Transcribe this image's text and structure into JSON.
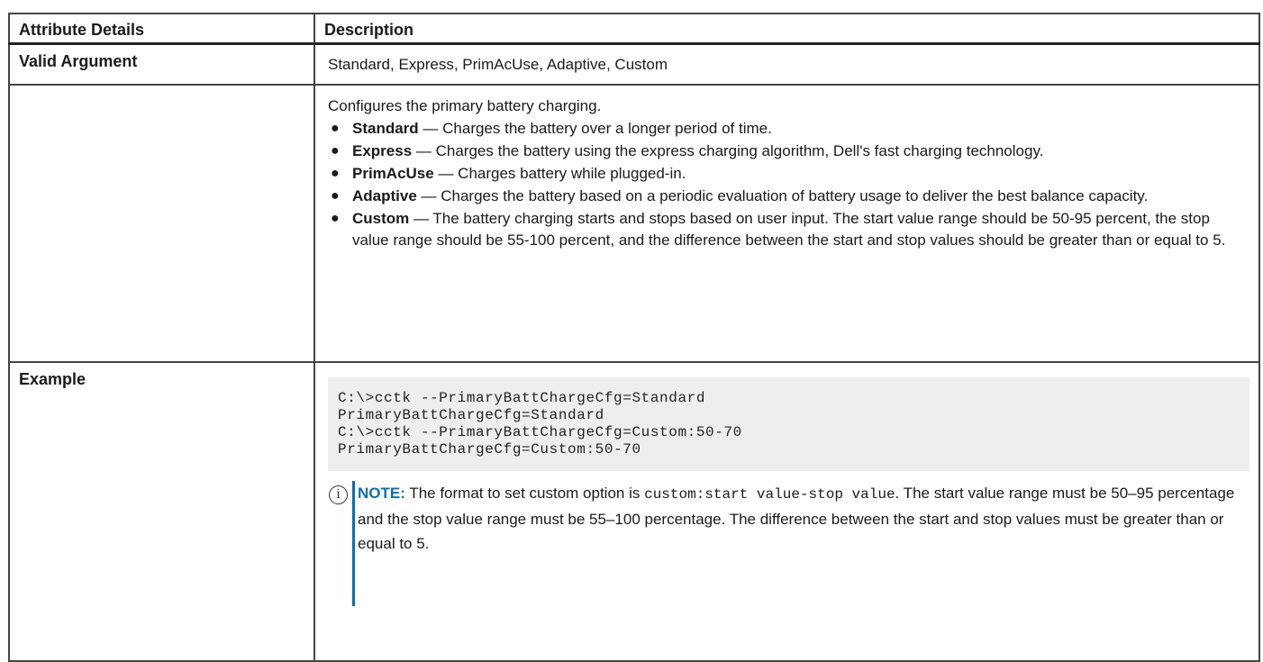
{
  "table": {
    "header": {
      "col1": "Attribute Details",
      "col2": "Description"
    },
    "valid_argument": {
      "label": "Valid Argument",
      "value": "Standard, Express, PrimAcUse, Adaptive, Custom"
    },
    "description": {
      "intro": "Configures the primary battery charging.",
      "options": [
        {
          "term": "Standard",
          "text": " — Charges the battery over a longer period of time."
        },
        {
          "term": "Express",
          "text": " — Charges the battery using the express charging algorithm, Dell's fast charging technology."
        },
        {
          "term": "PrimAcUse",
          "text": " — Charges battery while plugged-in."
        },
        {
          "term": "Adaptive",
          "text": " — Charges the battery based on a periodic evaluation of battery usage to deliver the best balance capacity."
        },
        {
          "term": "Custom",
          "text": " — The battery charging starts and stops based on user input. The start value range should be 50-95 percent, the stop value range should be 55-100 percent, and the difference between the start and stop values should be greater than or equal to 5."
        }
      ]
    },
    "example": {
      "label": "Example",
      "code_lines": [
        "C:\\>cctk --PrimaryBattChargeCfg=Standard",
        "PrimaryBattChargeCfg=Standard",
        "C:\\>cctk --PrimaryBattChargeCfg=Custom:50-70",
        "PrimaryBattChargeCfg=Custom:50-70"
      ],
      "note": {
        "icon": "info-icon",
        "label": "NOTE:",
        "text_before": " The format to set custom option is ",
        "code": "custom:start value-stop value",
        "text_after": ". The start value range must be 50–95 percentage and the stop value range must be 55–100 percentage. The difference between the start and stop values must be greater than or equal to 5."
      }
    }
  },
  "colors": {
    "note_accent": "#0a6fb5",
    "code_background": "#eeeeee"
  }
}
